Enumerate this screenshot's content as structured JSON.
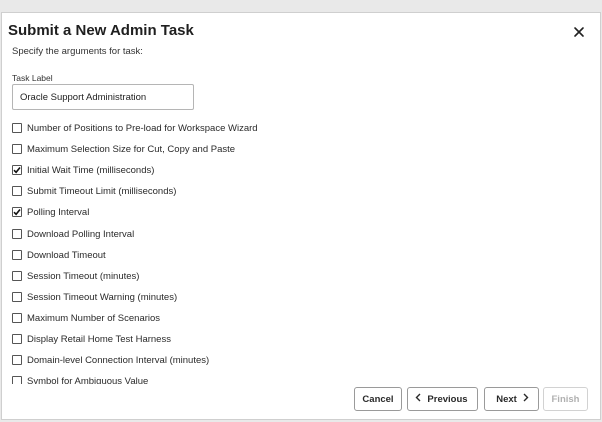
{
  "dialog": {
    "title": "Submit a New Admin Task",
    "subtitle": "Specify the arguments for task:"
  },
  "task_label": {
    "label": "Task Label",
    "value": "Oracle Support Administration"
  },
  "options": [
    {
      "label": "Number of Positions to Pre-load for Workspace Wizard",
      "checked": false
    },
    {
      "label": "Maximum Selection Size for Cut, Copy and Paste",
      "checked": false
    },
    {
      "label": "Initial Wait Time (milliseconds)",
      "checked": true
    },
    {
      "label": "Submit Timeout Limit (milliseconds)",
      "checked": false
    },
    {
      "label": "Polling Interval",
      "checked": true
    },
    {
      "label": "Download Polling Interval",
      "checked": false
    },
    {
      "label": "Download Timeout",
      "checked": false
    },
    {
      "label": "Session Timeout (minutes)",
      "checked": false
    },
    {
      "label": "Session Timeout Warning (minutes)",
      "checked": false
    },
    {
      "label": "Maximum Number of Scenarios",
      "checked": false
    },
    {
      "label": "Display Retail Home Test Harness",
      "checked": false
    },
    {
      "label": "Domain-level Connection Interval (minutes)",
      "checked": false
    },
    {
      "label": "Symbol for Ambiguous Value",
      "checked": false
    }
  ],
  "footer": {
    "cancel_label": "Cancel",
    "previous_label": "Previous",
    "next_label": "Next",
    "finish_label": "Finish"
  },
  "icons": {
    "close": "close-icon",
    "check": "checkmark-icon",
    "previous": "chevron-left-icon",
    "next": "chevron-right-icon"
  }
}
